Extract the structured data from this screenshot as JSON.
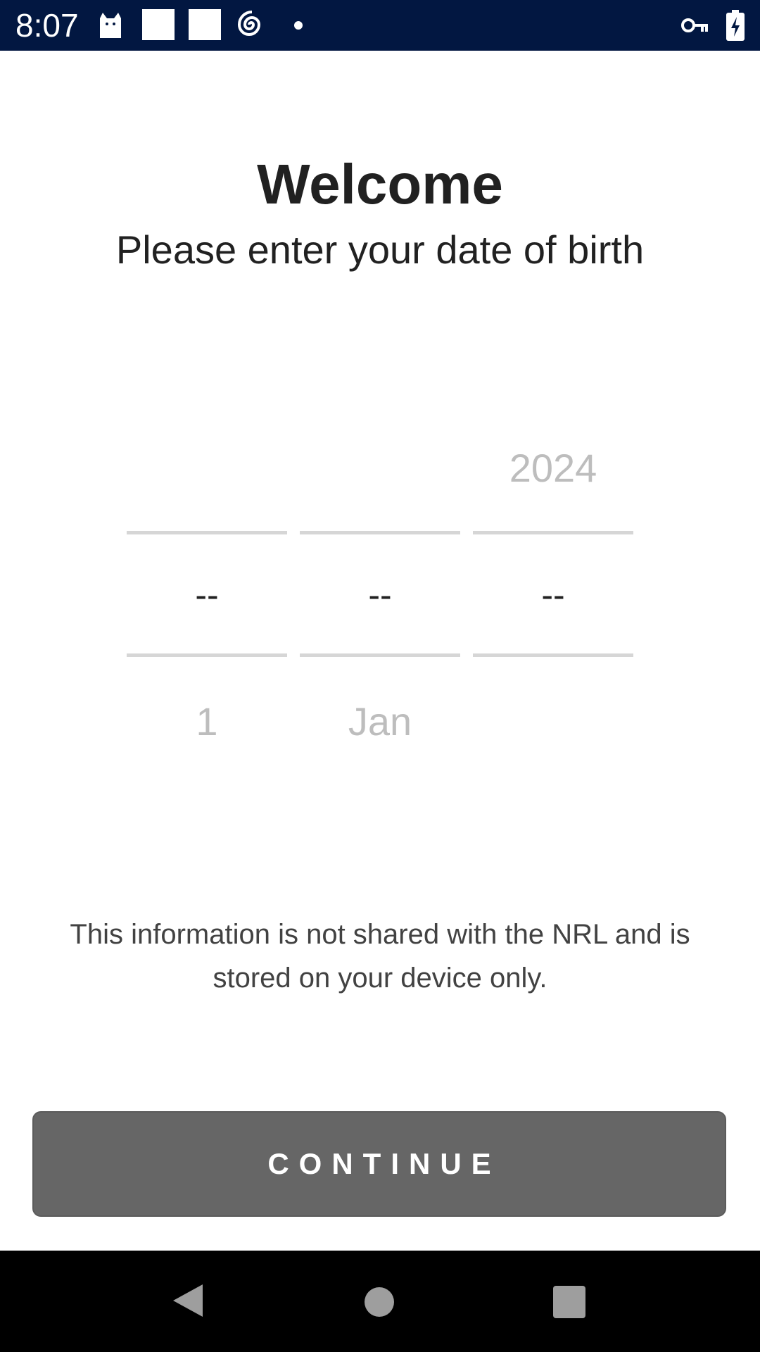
{
  "status_bar": {
    "time": "8:07",
    "icons": [
      "cat-icon",
      "square-icon",
      "square-icon",
      "spiral-icon",
      "dot-icon",
      "vpn-key-icon",
      "battery-charging-icon"
    ],
    "background": "#021741"
  },
  "header": {
    "title": "Welcome",
    "subtitle": "Please enter your date of birth"
  },
  "date_picker": {
    "day": {
      "above": "",
      "selected": "--",
      "below": "1"
    },
    "month": {
      "above": "",
      "selected": "--",
      "below": "Jan"
    },
    "year": {
      "above": "2024",
      "selected": "--",
      "below": ""
    }
  },
  "info_text": "This information is not shared with the NRL and is stored on your device only.",
  "continue_button": {
    "label": "CONTINUE",
    "color": "#666666"
  },
  "nav_bar": {
    "icons": [
      "back-icon",
      "home-icon",
      "recents-icon"
    ]
  }
}
